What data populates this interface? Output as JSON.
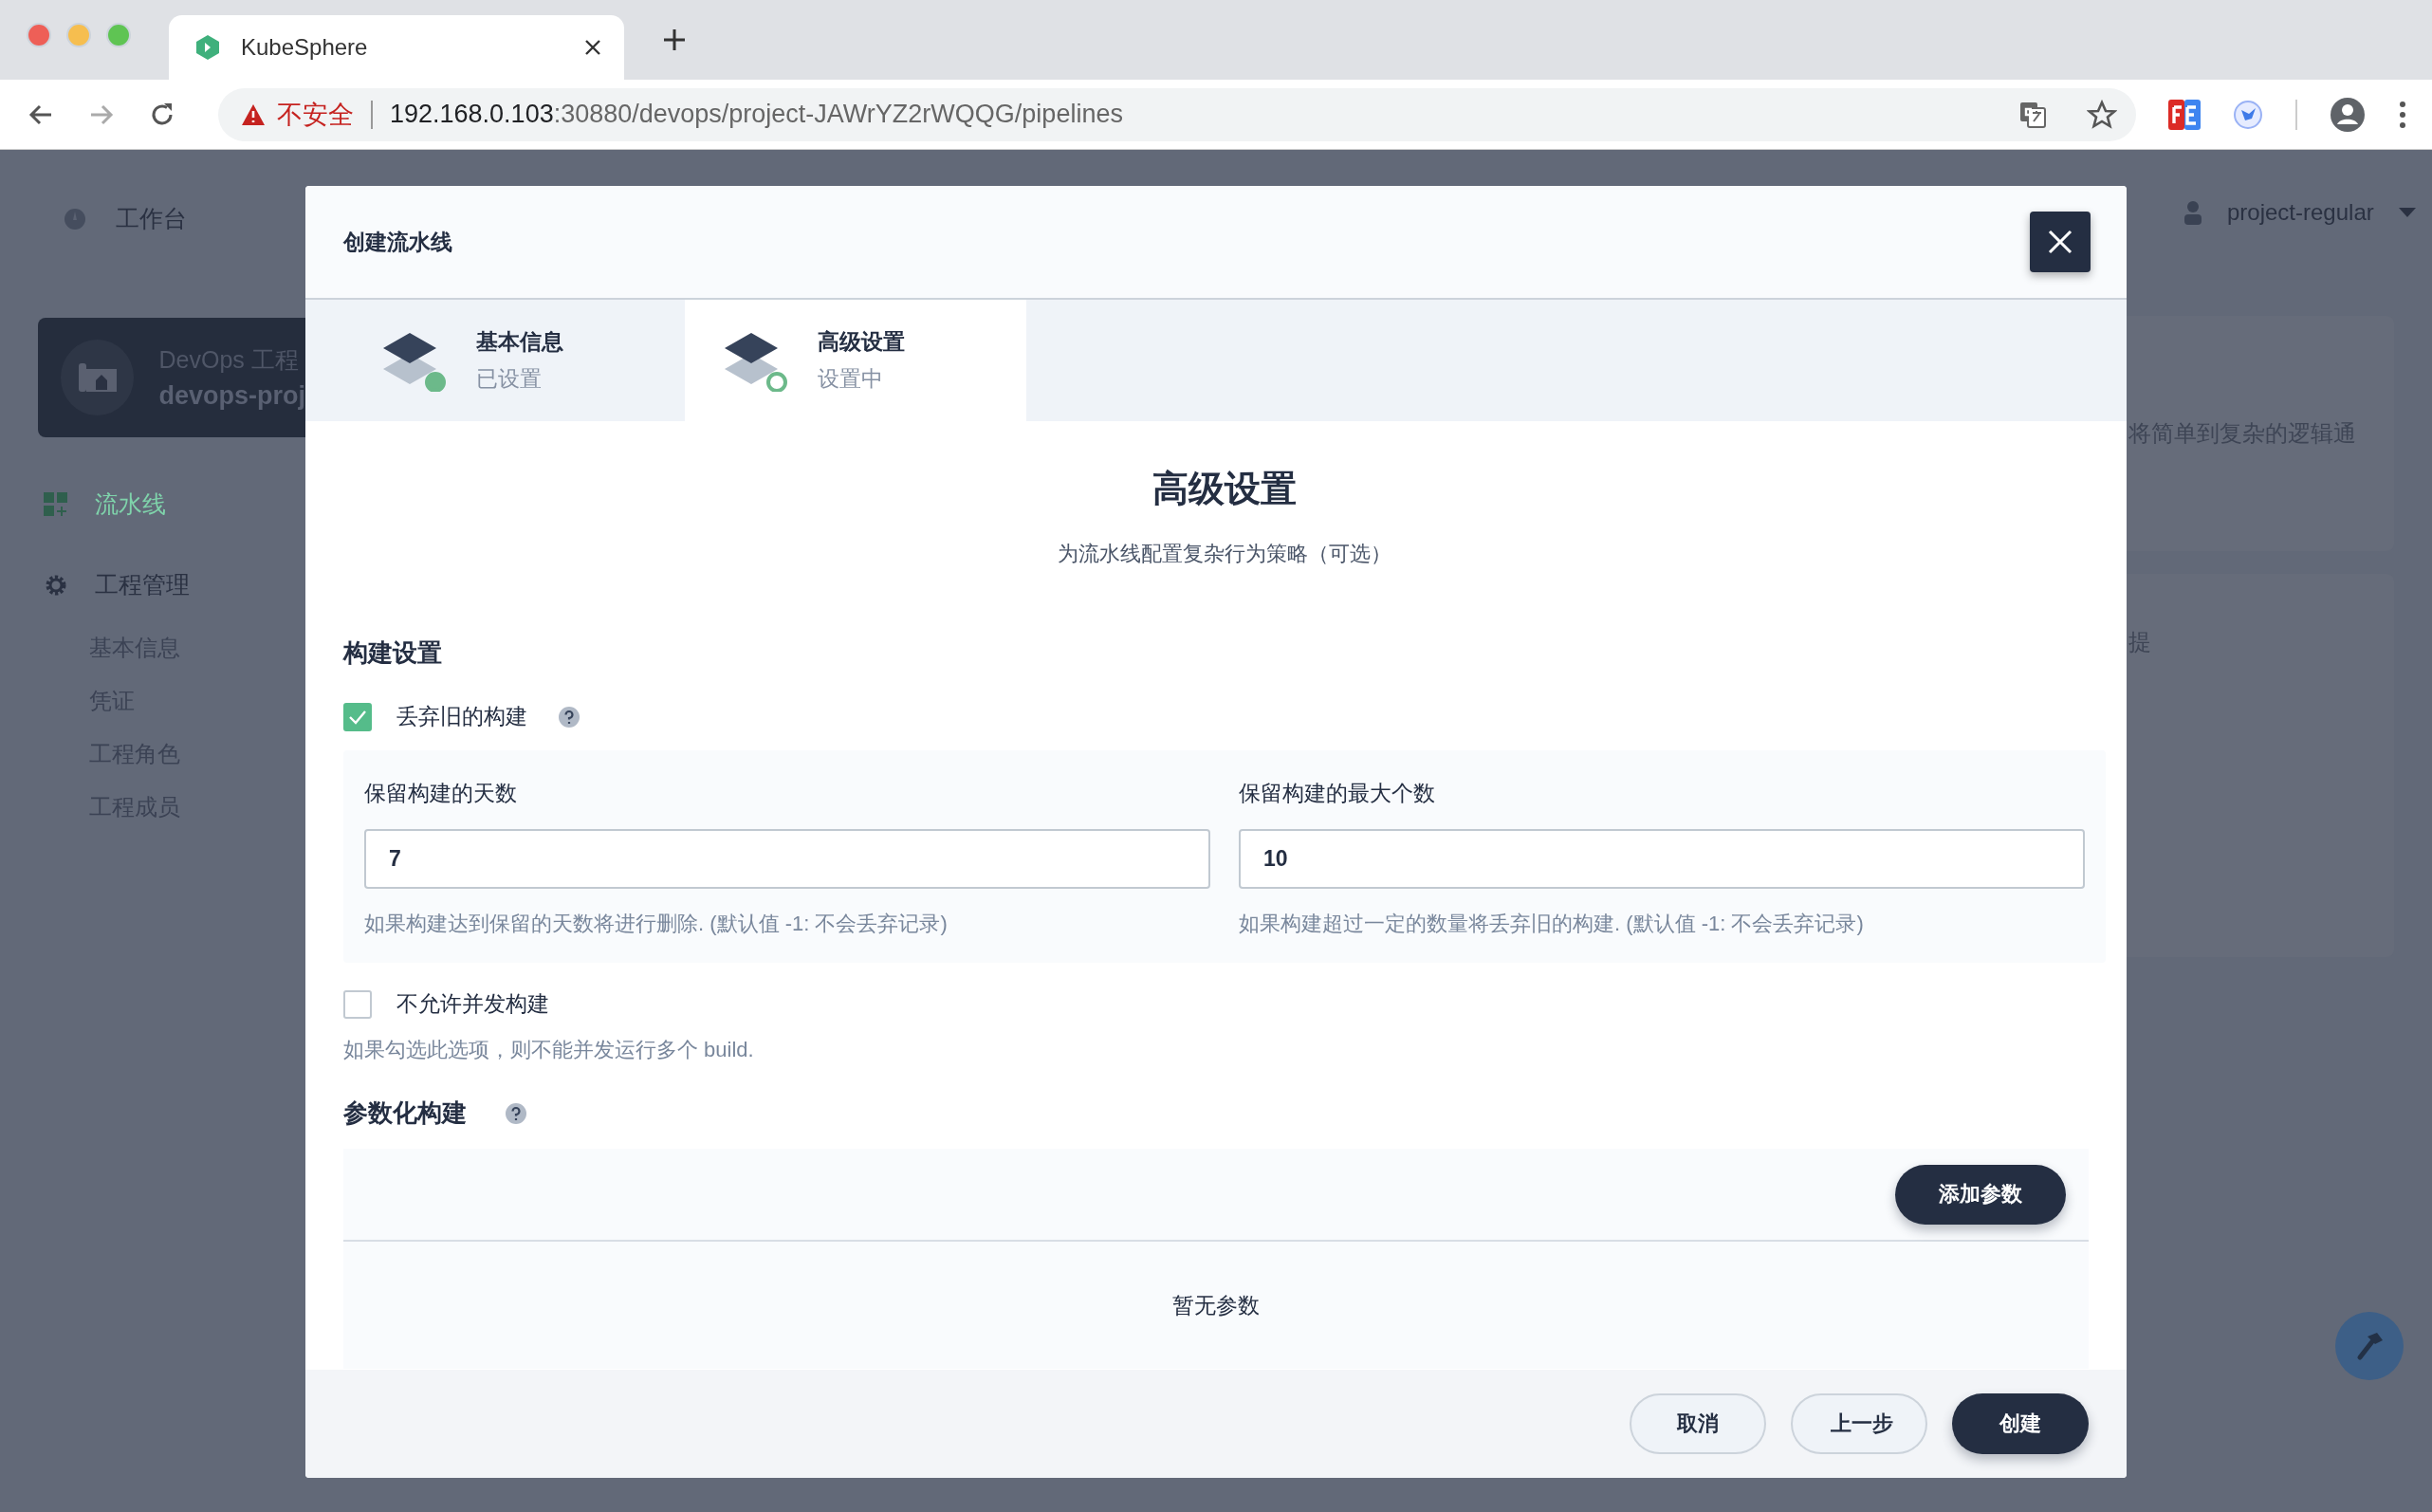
{
  "browser": {
    "tab_title": "KubeSphere",
    "security": "不安全",
    "url_host": "192.168.0.103",
    "url_path": ":30880/devops/project-JAWrYZ2rWQQG/pipelines"
  },
  "sidebar": {
    "workbench": "工作台",
    "project": {
      "type": "DevOps 工程",
      "name": "devops-proj"
    },
    "items": [
      {
        "label": "流水线",
        "kind": "nav",
        "selected": true
      },
      {
        "label": "工程管理",
        "kind": "group",
        "selected": false,
        "children": [
          {
            "label": "基本信息",
            "selected": false
          },
          {
            "label": "凭证",
            "selected": false
          },
          {
            "label": "工程角色",
            "selected": false
          },
          {
            "label": "工程成员",
            "selected": false
          }
        ]
      }
    ]
  },
  "header": {
    "user": "project-regular"
  },
  "background_cards": [
    {
      "text": "将简单到复杂的逻辑通"
    },
    {
      "text": "提"
    }
  ],
  "dialog": {
    "title": "创建流水线",
    "steps": [
      {
        "title": "基本信息",
        "status": "已设置",
        "done": true,
        "selected": false
      },
      {
        "title": "高级设置",
        "status": "设置中",
        "done": false,
        "selected": true
      }
    ],
    "heading": "高级设置",
    "subheading": "为流水线配置复杂行为策略（可选）",
    "build_settings": {
      "title": "构建设置",
      "discard_old": {
        "label": "丢弃旧的构建",
        "checked": true,
        "fields": [
          {
            "label": "保留构建的天数",
            "value": "7",
            "hint": "如果构建达到保留的天数将进行删除. (默认值 -1: 不会丢弃记录)"
          },
          {
            "label": "保留构建的最大个数",
            "value": "10",
            "hint": "如果构建超过一定的数量将丢弃旧的构建. (默认值 -1: 不会丢弃记录)"
          }
        ]
      },
      "no_concurrent": {
        "label": "不允许并发构建",
        "checked": false,
        "hint": "如果勾选此选项，则不能并发运行多个 build."
      }
    },
    "parameters": {
      "title": "参数化构建",
      "add_button": "添加参数",
      "empty": "暂无参数"
    },
    "buttons": [
      {
        "label": "取消",
        "kind": "secondary"
      },
      {
        "label": "上一步",
        "kind": "secondary"
      },
      {
        "label": "创建",
        "kind": "primary"
      }
    ]
  }
}
